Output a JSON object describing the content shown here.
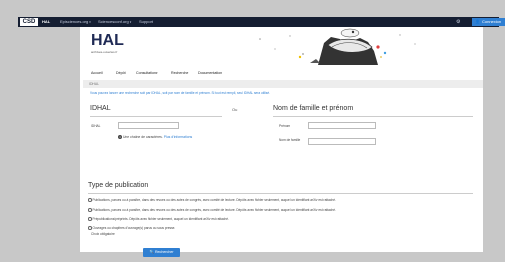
{
  "topbar": {
    "brand": "CSD",
    "hal_tag": "HAL",
    "links": [
      {
        "label": "Episciences.org",
        "has_caret": true
      },
      {
        "label": "Sciencesconf.org",
        "has_caret": true
      },
      {
        "label": "Support",
        "has_caret": false
      }
    ],
    "login_label": "Connexion"
  },
  "banner": {
    "logo": "HAL",
    "logo_subtitle": "archives-ouvertes.fr"
  },
  "mainnav": {
    "items": [
      {
        "label": "Accueil"
      },
      {
        "label": "Dépôt"
      },
      {
        "label": "Consultation",
        "has_caret": true
      },
      {
        "label": "Recherche"
      },
      {
        "label": "Documentation"
      }
    ]
  },
  "breadcrumb": "IDHAL",
  "hint": "Vous pouvez lancer une recherche soit par IDHAL, soit par nom de famille et prénom. Si tout est rempli, seul IDHAL sera utilisé.",
  "idhal": {
    "title": "IDHAL",
    "label": "IDHAL",
    "value": "",
    "help_text": "Une chaîne de caractères.",
    "more_info": "Plus d'informations"
  },
  "separator": "Ou",
  "name": {
    "title": "Nom de famille et prénom",
    "first_name_label": "Prénom",
    "last_name_label": "Nom de famille",
    "first_name_value": "",
    "last_name_value": ""
  },
  "pubtype": {
    "title": "Type de publication",
    "options": [
      "Publications, parues ou à paraître, dans des revues ou des actes de congrès, avec comité de lecture. Dépôts avec fichier seulement, auquel un identifiant arXiv est rattaché.",
      "Publications, parues ou à paraître, dans des revues ou des actes de congrès, avec comité de lecture. Dépôts avec fichier seulement, auquel un identifiant arXiv est rattaché.",
      "Prépublications/préprints. Dépôts avec fichier seulement, auquel un identifiant arXiv est rattaché.",
      "Ouvrages ou chapitres d'ouvrage(s) parus ou sous presse."
    ],
    "footnote": "Choix obligatoire"
  },
  "search_button": "Rechercher",
  "colors": {
    "topbar": "#151e32",
    "accent": "#2f7fd2",
    "logo": "#1f2a55"
  }
}
